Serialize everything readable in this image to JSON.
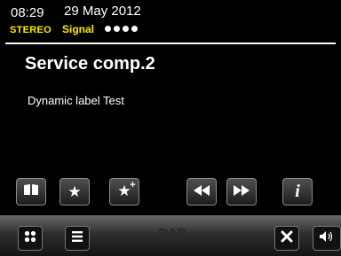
{
  "status": {
    "time": "08:29",
    "date": "29 May 2012",
    "stereo_label": "STEREO",
    "signal_label": "Signal",
    "signal_dots": 4,
    "accent_color": "#ffe800"
  },
  "station": {
    "name": "Service comp.2",
    "dynamic_label": "Dynamic label Test"
  },
  "controls": [
    {
      "name": "book-icon",
      "label": "presets"
    },
    {
      "name": "star-icon",
      "label": "favourite"
    },
    {
      "name": "star-plus-icon",
      "label": "add favourite"
    },
    {
      "name": "rewind-icon",
      "label": "previous"
    },
    {
      "name": "fast-forward-icon",
      "label": "next"
    },
    {
      "name": "info-icon",
      "label": "info"
    }
  ],
  "bottombar": {
    "mode_label": "DAB",
    "icons": [
      "grid-icon",
      "menu-icon",
      "close-icon",
      "speaker-icon"
    ]
  }
}
